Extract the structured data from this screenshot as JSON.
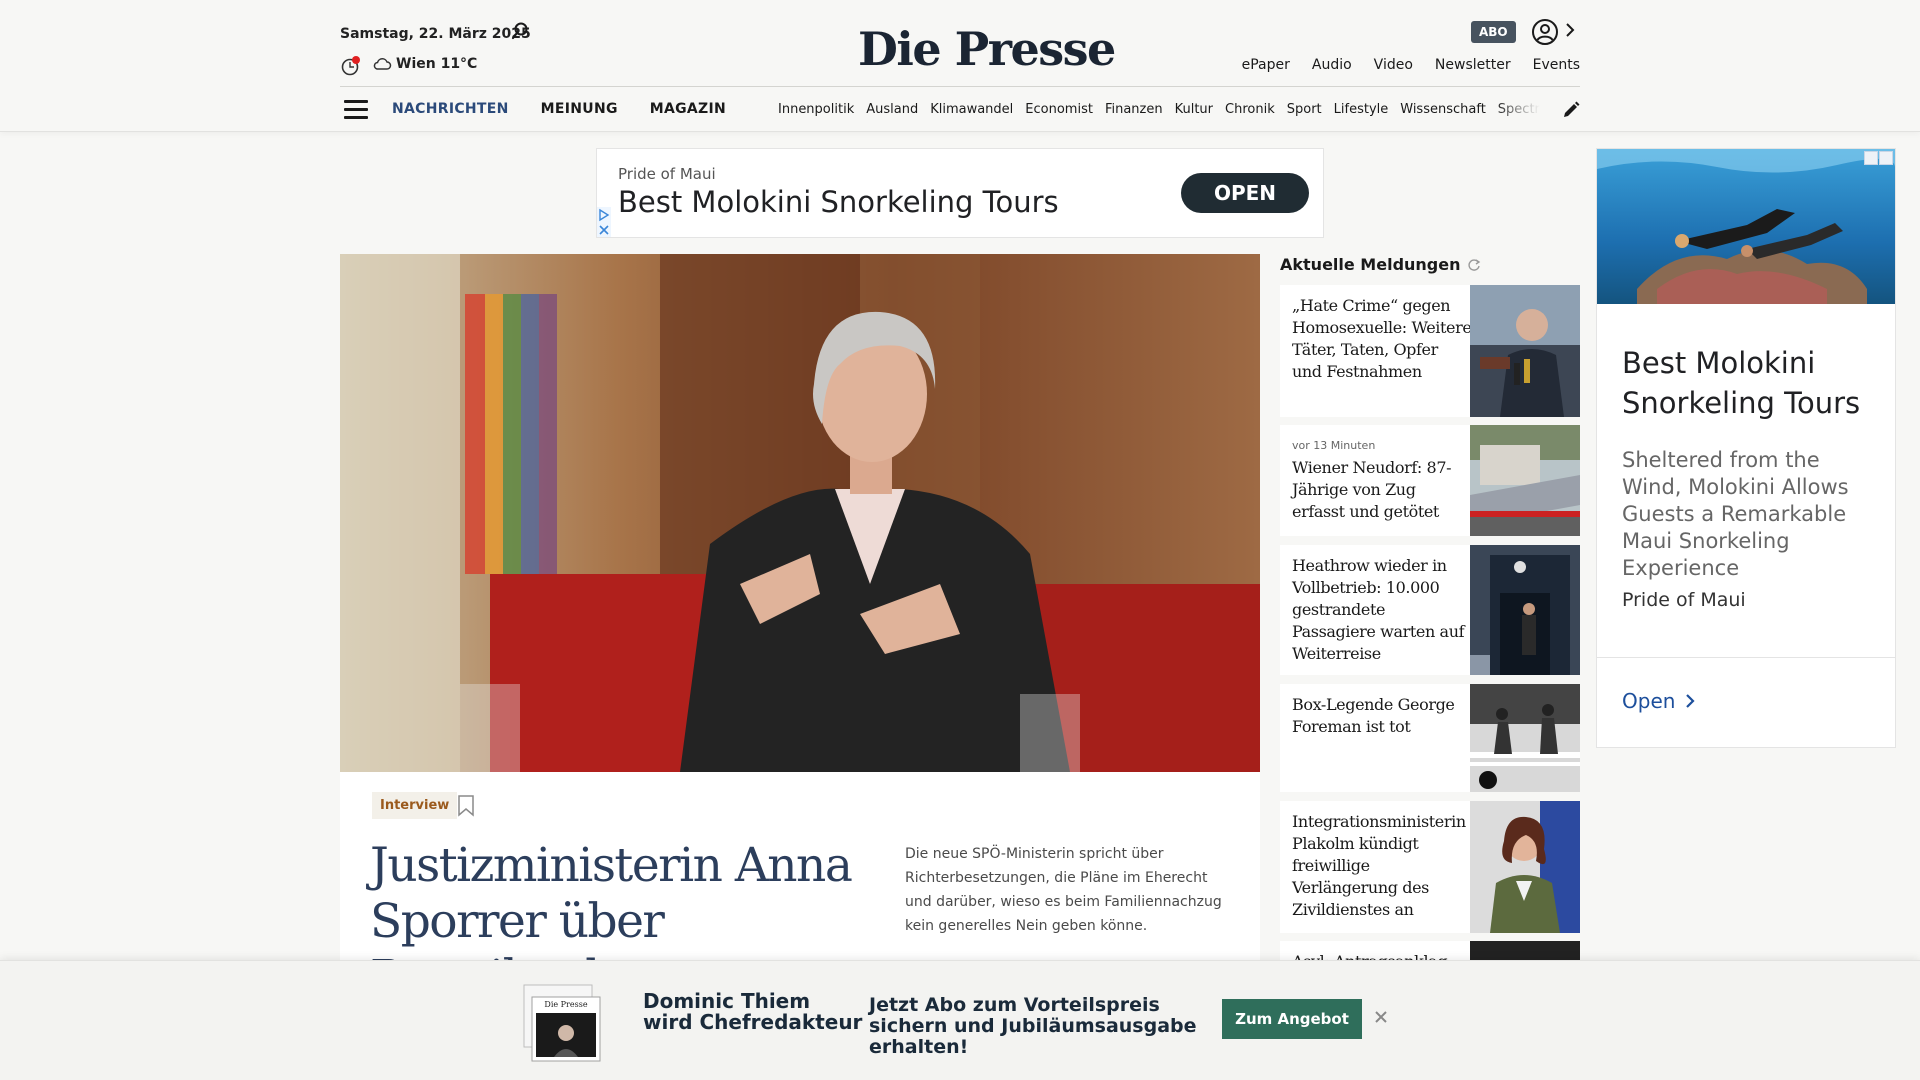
{
  "header": {
    "date": "Samstag, 22. März 2025",
    "weather": "Wien 11°C",
    "logo": "Die Presse",
    "abo": "ABO",
    "links": [
      "ePaper",
      "Audio",
      "Video",
      "Newsletter",
      "Events"
    ],
    "main_nav": [
      "NACHRICHTEN",
      "MEINUNG",
      "MAGAZIN"
    ],
    "sub_nav": [
      "Innenpolitik",
      "Ausland",
      "Klimawandel",
      "Economist",
      "Finanzen",
      "Kultur",
      "Chronik",
      "Sport",
      "Lifestyle",
      "Wissenschaft",
      "Spectrum"
    ],
    "colors": {
      "nav_active": "#2b4a7a",
      "abo_bg": "#47535f",
      "logo": "#1b2533"
    }
  },
  "ad_top": {
    "brand": "Pride of Maui",
    "title": "Best Molokini Snorkeling Tours",
    "button": "OPEN"
  },
  "lead": {
    "tag": "Interview",
    "headline": "Justizministerin Anna Sporrer über Parteibuch",
    "teaser": "Die neue SPÖ-Ministerin spricht über Richterbesetzungen, die Pläne im Eherecht und darüber, wieso es beim Familiennachzug kein generelles Nein geben könne."
  },
  "news": {
    "title": "Aktuelle Meldungen",
    "items": [
      {
        "meta": "",
        "text": "„Hate Crime“ gegen Homosexuelle: Weitere Täter, Taten, Opfer und Festnahmen"
      },
      {
        "meta": "vor 13 Minuten",
        "text": "Wiener Neudorf: 87-Jährige von Zug erfasst und getötet"
      },
      {
        "meta": "",
        "text": "Heathrow wieder in Vollbetrieb: 10.000 gestrandete Passagiere warten auf Weiterreise"
      },
      {
        "meta": "",
        "text": "Box-Legende George Foreman ist tot"
      },
      {
        "meta": "",
        "text": "Integrationsministerin Plakolm kündigt freiwillige Verlängerung des Zivildienstes an"
      },
      {
        "meta": "",
        "text": "Asyl: Antragsanklag…"
      }
    ]
  },
  "ad_right": {
    "title": "Best Molokini Snorkeling Tours",
    "description": "Sheltered from the Wind, Molokini Allows Guests a Remarkable Maui Snorkeling Experience",
    "brand": "Pride of Maui",
    "open": "Open"
  },
  "banner": {
    "headline": "Dominic Thiem wird Chefredakteur",
    "offer": "Jetzt Abo zum Vorteilspreis sichern und Jubiläumsausgabe erhalten!",
    "cta": "Zum Angebot",
    "paper_masthead": "Die Presse",
    "colors": {
      "cta": "#2f6e5b"
    }
  }
}
